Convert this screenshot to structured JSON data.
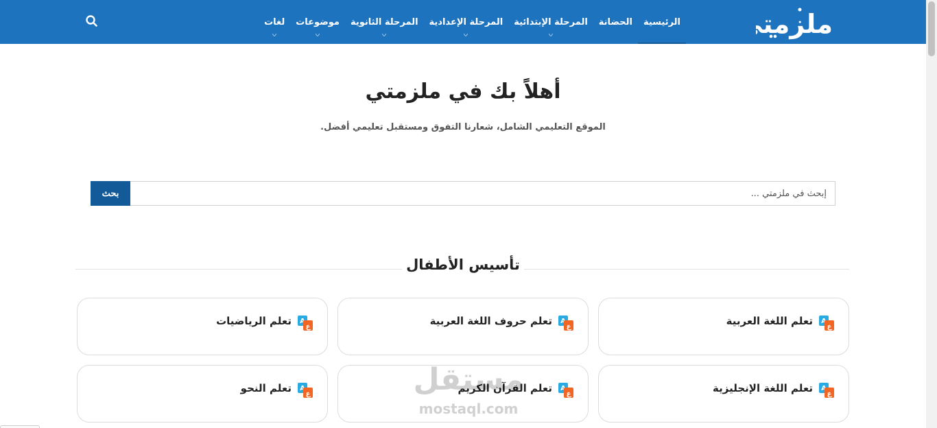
{
  "header": {
    "logo_text": "ملزمتي",
    "nav": [
      {
        "label": "الرئيسية",
        "active": true,
        "has_submenu": false
      },
      {
        "label": "الحضانة",
        "active": false,
        "has_submenu": false
      },
      {
        "label": "المرحلة الإبتدائية",
        "active": false,
        "has_submenu": true
      },
      {
        "label": "المرحلة الإعدادية",
        "active": false,
        "has_submenu": true
      },
      {
        "label": "المرحلة الثانوية",
        "active": false,
        "has_submenu": true
      },
      {
        "label": "موضوعات",
        "active": false,
        "has_submenu": true
      },
      {
        "label": "لغات",
        "active": false,
        "has_submenu": true
      }
    ],
    "search_icon": "search-icon"
  },
  "hero": {
    "title": "أهلاً بك في ملزمتي",
    "subtitle": "الموقع التعليمي الشامل، شعارنا التفوق ومستقبل تعليمي أفضل."
  },
  "search": {
    "placeholder": "إبحث في ملزمتي ...",
    "button_label": "بحث"
  },
  "section": {
    "title": "تأسيس الأطفال",
    "cards": [
      {
        "label": "تعلم اللغة العربية",
        "icon": "language-icon"
      },
      {
        "label": "تعلم حروف اللغة العربية",
        "icon": "language-icon"
      },
      {
        "label": "تعلم الرياضيات",
        "icon": "language-icon"
      },
      {
        "label": "تعلم اللغة الإنجليزية",
        "icon": "language-icon"
      },
      {
        "label": "تعلم القرآن الكريم",
        "icon": "language-icon"
      },
      {
        "label": "تعلم النحو",
        "icon": "language-icon"
      }
    ]
  },
  "watermark": {
    "arabic": "مستقل",
    "latin": "mostaql.com"
  },
  "colors": {
    "header_bg": "#1e73be",
    "button_bg": "#135a99",
    "icon_orange": "#f26522",
    "icon_blue": "#29abe2"
  }
}
